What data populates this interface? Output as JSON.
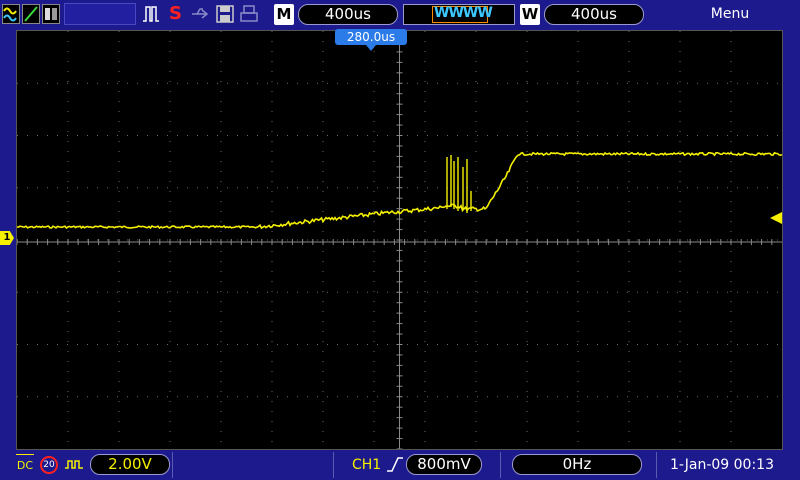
{
  "topbar": {
    "icons": [
      "dual-wave-icon",
      "yt-mode-icon",
      "roll-icon",
      "blank-slot-icon",
      "pulse-icon",
      "stop-indicator-icon",
      "usb-icon",
      "save-icon",
      "print-icon"
    ],
    "stop_label": "S",
    "timebase_mode_label": "M",
    "timebase_value": "400us",
    "waveform_preview_label": "WWWW",
    "window_mode_label": "W",
    "window_value": "400us",
    "menu_label": "Menu"
  },
  "screen": {
    "trigger_position": "280.0us",
    "channel_marker": "1",
    "trace_color": "#f4f000"
  },
  "bottombar": {
    "coupling": "DC",
    "bandwidth_limit": "20",
    "volts_div": "2.00V",
    "trigger_source": "CH1",
    "trigger_level": "800mV",
    "frequency": "0Hz",
    "datetime": "1-Jan-09 00:13"
  },
  "colors": {
    "frame": "#1c1a8c",
    "screen": "#000000",
    "trace": "#f4f000",
    "accent": "#2b7be8"
  }
}
